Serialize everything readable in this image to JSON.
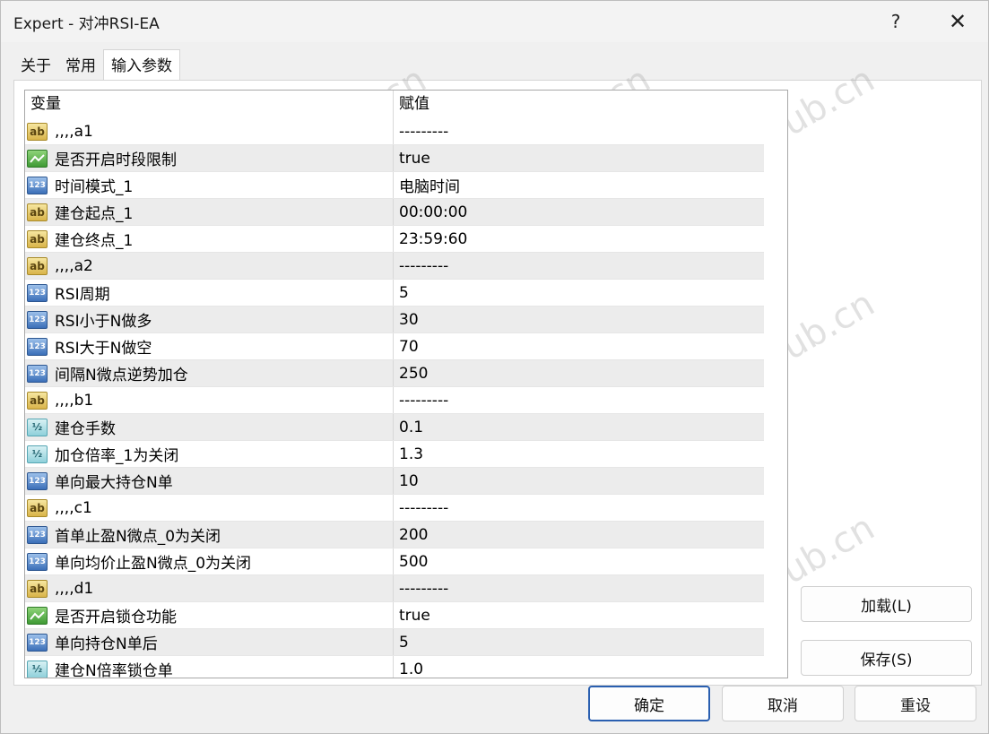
{
  "window": {
    "title": "Expert - 对冲RSI-EA",
    "help_label": "?",
    "close_label": "✕"
  },
  "tabs": [
    {
      "label": "关于"
    },
    {
      "label": "常用"
    },
    {
      "label": "输入参数",
      "active": true
    }
  ],
  "grid": {
    "columns": {
      "variable": "变量",
      "value": "赋值"
    },
    "rows": [
      {
        "type": "string",
        "name": ",,,,a1",
        "value": "---------"
      },
      {
        "type": "bool",
        "name": "是否开启时段限制",
        "value": "true"
      },
      {
        "type": "int",
        "name": "时间模式_1",
        "value": "电脑时间"
      },
      {
        "type": "string",
        "name": "建仓起点_1",
        "value": "00:00:00"
      },
      {
        "type": "string",
        "name": "建仓终点_1",
        "value": "23:59:60"
      },
      {
        "type": "string",
        "name": ",,,,a2",
        "value": "---------"
      },
      {
        "type": "int",
        "name": "RSI周期",
        "value": "5"
      },
      {
        "type": "int",
        "name": "RSI小于N做多",
        "value": "30"
      },
      {
        "type": "int",
        "name": "RSI大于N做空",
        "value": "70"
      },
      {
        "type": "int",
        "name": "间隔N微点逆势加仓",
        "value": "250"
      },
      {
        "type": "string",
        "name": ",,,,b1",
        "value": "---------"
      },
      {
        "type": "double",
        "name": "建仓手数",
        "value": "0.1"
      },
      {
        "type": "double",
        "name": "加仓倍率_1为关闭",
        "value": "1.3"
      },
      {
        "type": "int",
        "name": "单向最大持仓N单",
        "value": "10"
      },
      {
        "type": "string",
        "name": ",,,,c1",
        "value": "---------"
      },
      {
        "type": "int",
        "name": "首单止盈N微点_0为关闭",
        "value": "200"
      },
      {
        "type": "int",
        "name": "单向均价止盈N微点_0为关闭",
        "value": "500"
      },
      {
        "type": "string",
        "name": ",,,,d1",
        "value": "---------"
      },
      {
        "type": "bool",
        "name": "是否开启锁仓功能",
        "value": "true"
      },
      {
        "type": "int",
        "name": "单向持仓N单后",
        "value": "5"
      },
      {
        "type": "double",
        "name": "建仓N倍率锁仓单",
        "value": "1.0"
      }
    ]
  },
  "icons": {
    "string": "ab-icon",
    "int": "123-icon",
    "bool": "bool-icon",
    "double": "half-icon"
  },
  "buttons": {
    "load": "加载(L)",
    "save": "保存(S)",
    "ok": "确定",
    "cancel": "取消",
    "reset": "重设"
  },
  "watermark": "EAHub.cn",
  "colors": {
    "ok_border": "#2a5fb0",
    "row_alt": "#ececec"
  }
}
